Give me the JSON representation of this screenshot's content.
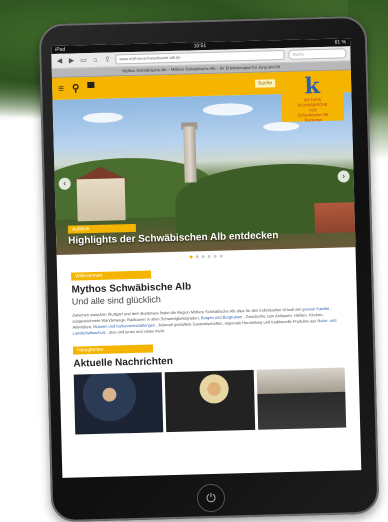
{
  "browser": {
    "status_left": "iPad",
    "status_time": "10:51",
    "status_right": "61 %",
    "url": "www.mythos-schwaebische-alb.de",
    "search_placeholder": "Suche",
    "tab_title": "Mythos Schwäbische Alb – Mittlere Schwäbische Alb – Ihr Erlebnisregion für Jung und Alt"
  },
  "header": {
    "menu_icon": "≡",
    "search_icon": "⚲",
    "bed_icon": "▀",
    "badge": "Suche",
    "logo_letter": "k",
    "logo_line1": "MYTHOS",
    "logo_line2": "SCHWÄBISCHE",
    "logo_line3": "ALB",
    "logo_line4": "Schwäbische Alb",
    "logo_line5": "Tourismus"
  },
  "hero": {
    "tag": "Aufblick",
    "title": "Highlights der Schwäbischen Alb entdecken",
    "prev": "‹",
    "next": "›"
  },
  "intro": {
    "tag": "Willkommen",
    "title": "Mythos Schwäbische Alb",
    "subtitle": "Und alle sind glücklich",
    "text1": "Zwischen zwischen Stuttgart und dem Bodensee findet die Region Mittlere Schwäbische Alb alles für den individuellen Urlaub der",
    "link1": "ganzen Familie",
    "text2": ", ausgezeichnete Wanderwege, Radtouren in allen Schwierigkeitsgraden,",
    "link2": "Burgen und Burgruinen",
    "text3": ", Geschichte zum Anfassen. Höhlen, Kirchen, Aktivitäten,",
    "link3": "Museen und Kulturveranstaltungen",
    "text4": ", liebevoll gestaltete Gastwirtschaften, regionale Herstellung und traditionelle Produkte aus",
    "link4": "Natur- und Landschaftsschutz",
    "text5": ", dies und jenes und vieles mehr."
  },
  "news": {
    "tag": "Neuigkeiten",
    "title": "Aktuelle Nachrichten"
  },
  "device": {
    "home_icon": "⏻"
  }
}
